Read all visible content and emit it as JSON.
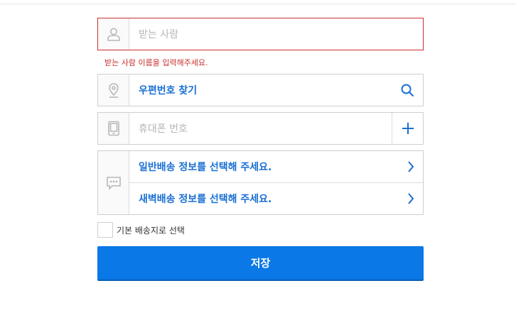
{
  "recipient": {
    "placeholder": "받는 사람",
    "error": "받는 사람 이름을 입력해주세요."
  },
  "postcode": {
    "label": "우편번호 찾기"
  },
  "phone": {
    "placeholder": "휴대폰 번호"
  },
  "delivery": {
    "general": "일반배송 정보를 선택해 주세요.",
    "dawn": "새벽배송 정보를 선택해 주세요."
  },
  "default_checkbox": {
    "label": "기본 배송지로 선택",
    "checked": false
  },
  "save_label": "저장",
  "colors": {
    "accent": "#1a6fd4",
    "button": "#0a78e6",
    "error": "#c9302c",
    "icon": "#b8b8b8"
  },
  "icons": [
    "person-icon",
    "location-pin-icon",
    "search-icon",
    "phone-icon",
    "plus-icon",
    "chat-bubble-icon",
    "chevron-right-icon"
  ]
}
